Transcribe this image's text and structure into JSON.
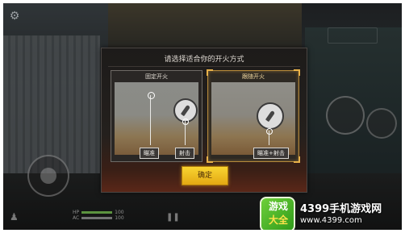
{
  "dialog": {
    "title": "请选择适合你的开火方式",
    "options": [
      {
        "label": "固定开火",
        "selected": false,
        "buttons": [
          "瞄准",
          "射击"
        ]
      },
      {
        "label": "跟随开火",
        "selected": true,
        "buttons": [
          "瞄准+射击"
        ]
      }
    ],
    "confirm_label": "确定"
  },
  "hud": {
    "hp_label": "HP",
    "hp_value": "100",
    "ac_label": "AC",
    "ac_value": "100"
  },
  "watermark": {
    "logo_top": "游戏",
    "logo_bottom": "大全",
    "name": "4399手机游戏网",
    "url": "www.4399.com"
  },
  "colors": {
    "accent": "#e8b24a",
    "confirm": "#f2c125",
    "hp_bar": "#6fb34a"
  }
}
